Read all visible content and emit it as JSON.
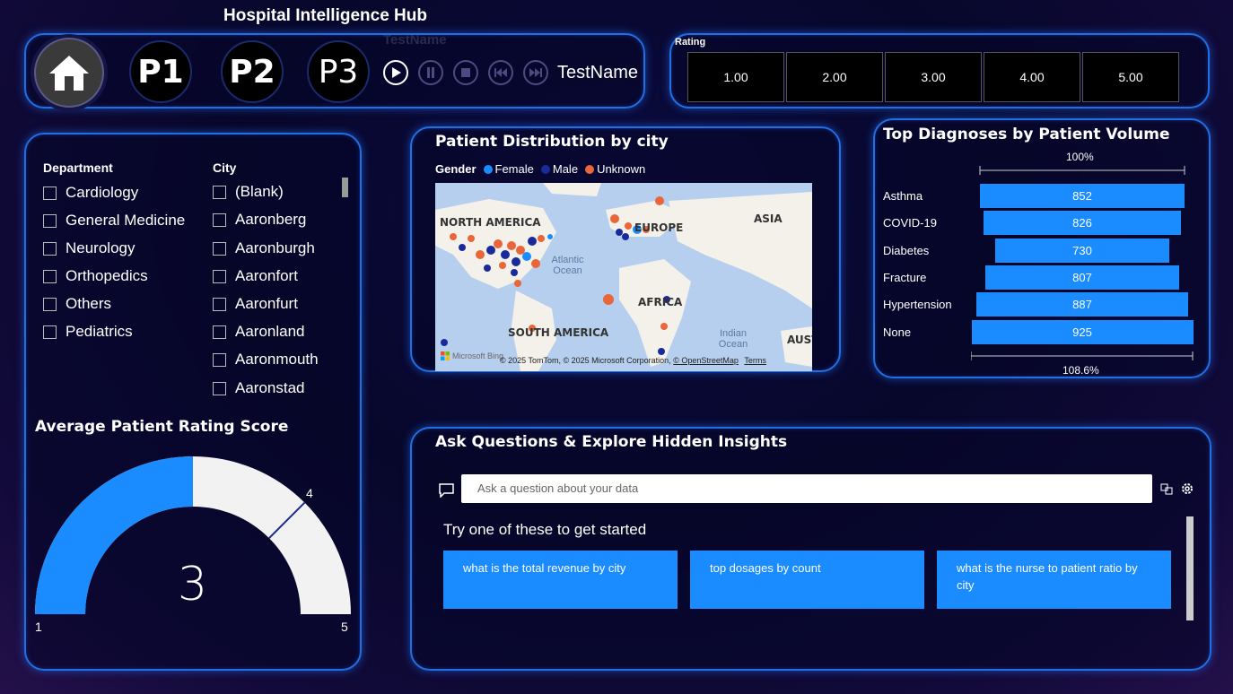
{
  "header": {
    "title": "Hospital Intelligence Hub",
    "ghost_label": "TestName",
    "nav": [
      "P1",
      "P2",
      "P3"
    ],
    "playback_label": "TestName"
  },
  "rating_slicer": {
    "label": "Rating",
    "options": [
      "1.00",
      "2.00",
      "3.00",
      "4.00",
      "5.00"
    ]
  },
  "filters": {
    "department": {
      "header": "Department",
      "items": [
        "Cardiology",
        "General Medicine",
        "Neurology",
        "Orthopedics",
        "Others",
        "Pediatrics"
      ]
    },
    "city": {
      "header": "City",
      "items": [
        "(Blank)",
        "Aaronberg",
        "Aaronburgh",
        "Aaronfort",
        "Aaronfurt",
        "Aaronland",
        "Aaronmouth",
        "Aaronstad"
      ]
    }
  },
  "gauge": {
    "title": "Average Patient Rating Score",
    "min_label": "1",
    "max_label": "5",
    "target_label": "4",
    "value_label": "3",
    "min": 1,
    "max": 5,
    "value": 3,
    "target": 4,
    "colors": {
      "fill": "#1a8cff",
      "track": "#f2f2f2",
      "target": "#1a2a8a"
    }
  },
  "map": {
    "title": "Patient Distribution by city",
    "legend_title": "Gender",
    "legend": [
      {
        "label": "Female",
        "color": "#1a8cff"
      },
      {
        "label": "Male",
        "color": "#1a2a9a"
      },
      {
        "label": "Unknown",
        "color": "#e8663a"
      }
    ],
    "labels": [
      "NORTH AMERICA",
      "EUROPE",
      "ASIA",
      "AFRICA",
      "SOUTH AMERICA",
      "AUST"
    ],
    "oceans": [
      "Atlantic Ocean",
      "Indian Ocean"
    ],
    "attribution": "© 2025 TomTom, © 2025 Microsoft Corporation,",
    "osm": "© OpenStreetMap",
    "terms": "Terms",
    "bing": "Microsoft Bing"
  },
  "diagnoses": {
    "title": "Top Diagnoses by Patient Volume",
    "top_label": "100%",
    "bottom_label": "108.6%",
    "colors": {
      "bar": "#1a8cff"
    }
  },
  "chart_data": {
    "type": "bar",
    "title": "Top Diagnoses by Patient Volume",
    "categories": [
      "Asthma",
      "COVID-19",
      "Diabetes",
      "Fracture",
      "Hypertension",
      "None"
    ],
    "values": [
      852,
      826,
      730,
      807,
      887,
      925
    ]
  },
  "qa": {
    "title": "Ask Questions & Explore Hidden Insights",
    "placeholder": "Ask a question about your data",
    "prompt": "Try one of these to get started",
    "suggestions": [
      "what is the total revenue by city",
      "top dosages by count",
      "what is the nurse to patient ratio by city"
    ]
  }
}
